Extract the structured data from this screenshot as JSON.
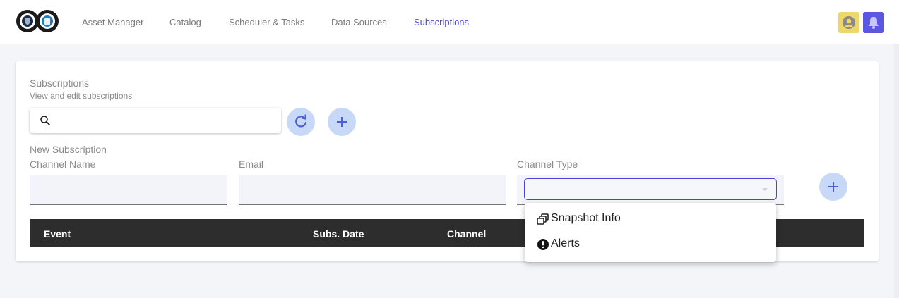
{
  "nav": {
    "items": [
      {
        "label": "Asset Manager"
      },
      {
        "label": "Catalog"
      },
      {
        "label": "Scheduler & Tasks"
      },
      {
        "label": "Data Sources"
      },
      {
        "label": "Subscriptions",
        "active": true
      }
    ]
  },
  "page": {
    "title": "Subscriptions",
    "subtitle": "View and edit subscriptions"
  },
  "search": {
    "value": "",
    "placeholder": ""
  },
  "form": {
    "section_title": "New Subscription",
    "channel_name_label": "Channel Name",
    "email_label": "Email",
    "channel_type_label": "Channel Type",
    "channel_name_value": "",
    "email_value": "",
    "channel_type_value": ""
  },
  "table": {
    "columns": [
      "Event",
      "Subs. Date",
      "Channel"
    ],
    "rows": []
  },
  "dropdown": {
    "options": [
      {
        "label": "Snapshot Info",
        "icon": "snapshot-icon"
      },
      {
        "label": "Alerts",
        "icon": "alert-icon"
      }
    ]
  },
  "colors": {
    "accent": "#4a44d9",
    "user_button": "#f0d66a",
    "bell_button": "#5b57e0",
    "round_button": "#c8d9f8",
    "table_header": "#2d2d2d"
  }
}
